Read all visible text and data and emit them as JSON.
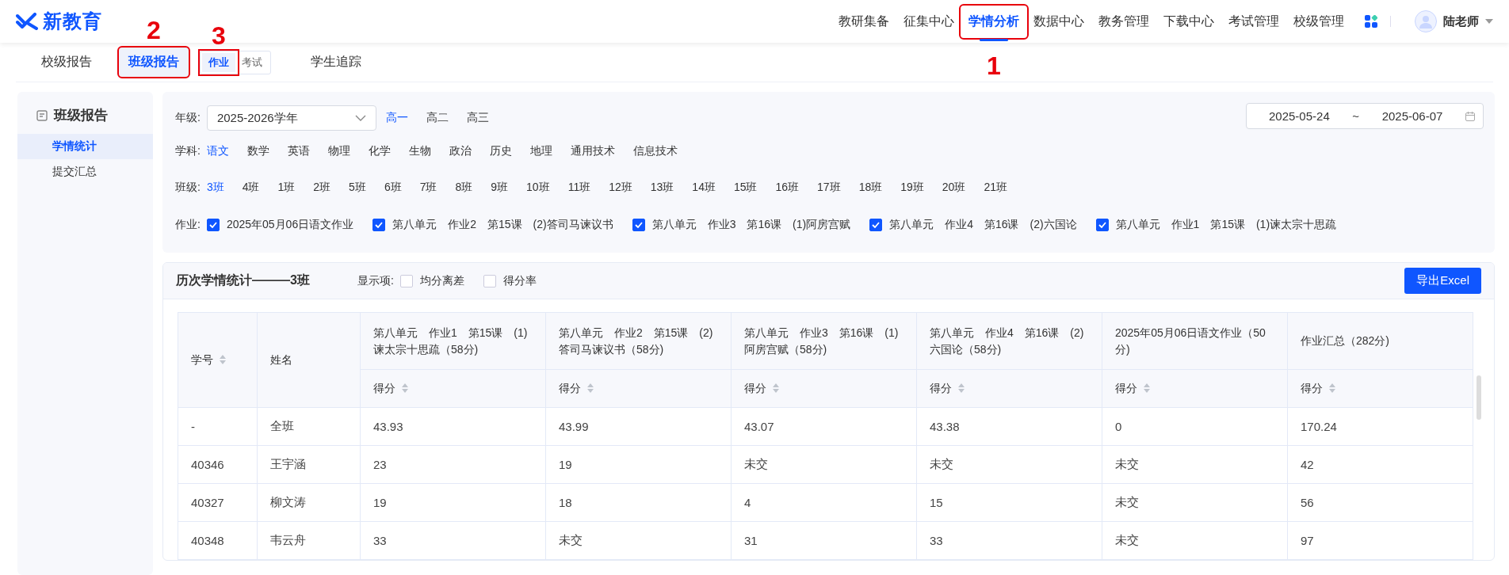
{
  "header": {
    "logo": "新教育",
    "nav": [
      {
        "label": "教研集备",
        "selected": false
      },
      {
        "label": "征集中心",
        "selected": false
      },
      {
        "label": "学情分析",
        "selected": true,
        "callout": "1"
      },
      {
        "label": "数据中心",
        "selected": false
      },
      {
        "label": "教务管理",
        "selected": false
      },
      {
        "label": "下载中心",
        "selected": false
      },
      {
        "label": "考试管理",
        "selected": false
      },
      {
        "label": "校级管理",
        "selected": false
      }
    ],
    "user": "陆老师"
  },
  "tabs": [
    {
      "label": "校级报告",
      "selected": false
    },
    {
      "label": "班级报告",
      "selected": true,
      "callout": "2",
      "subtabs": [
        {
          "label": "作业",
          "selected": true,
          "callout": "3"
        },
        {
          "label": "考试",
          "selected": false
        }
      ]
    },
    {
      "label": "学生追踪",
      "selected": false
    }
  ],
  "sidebar": {
    "title": "班级报告",
    "items": [
      {
        "label": "学情统计",
        "selected": true
      },
      {
        "label": "提交汇总",
        "selected": false
      }
    ]
  },
  "filters": {
    "grade": {
      "label": "年级:",
      "value": "2025-2026学年",
      "options": [
        {
          "label": "高一",
          "selected": true
        },
        {
          "label": "高二",
          "selected": false
        },
        {
          "label": "高三",
          "selected": false
        }
      ]
    },
    "date_range": {
      "start": "2025-05-24",
      "separator": "~",
      "end": "2025-06-07"
    },
    "subject": {
      "label": "学科:",
      "options": [
        {
          "label": "语文",
          "selected": true
        },
        {
          "label": "数学",
          "selected": false
        },
        {
          "label": "英语",
          "selected": false
        },
        {
          "label": "物理",
          "selected": false
        },
        {
          "label": "化学",
          "selected": false
        },
        {
          "label": "生物",
          "selected": false
        },
        {
          "label": "政治",
          "selected": false
        },
        {
          "label": "历史",
          "selected": false
        },
        {
          "label": "地理",
          "selected": false
        },
        {
          "label": "通用技术",
          "selected": false
        },
        {
          "label": "信息技术",
          "selected": false
        }
      ]
    },
    "class": {
      "label": "班级:",
      "options": [
        {
          "label": "3班",
          "selected": true
        },
        {
          "label": "4班",
          "selected": false
        },
        {
          "label": "1班",
          "selected": false
        },
        {
          "label": "2班",
          "selected": false
        },
        {
          "label": "5班",
          "selected": false
        },
        {
          "label": "6班",
          "selected": false
        },
        {
          "label": "7班",
          "selected": false
        },
        {
          "label": "8班",
          "selected": false
        },
        {
          "label": "9班",
          "selected": false
        },
        {
          "label": "10班",
          "selected": false
        },
        {
          "label": "11班",
          "selected": false
        },
        {
          "label": "12班",
          "selected": false
        },
        {
          "label": "13班",
          "selected": false
        },
        {
          "label": "14班",
          "selected": false
        },
        {
          "label": "15班",
          "selected": false
        },
        {
          "label": "16班",
          "selected": false
        },
        {
          "label": "17班",
          "selected": false
        },
        {
          "label": "18班",
          "selected": false
        },
        {
          "label": "19班",
          "selected": false
        },
        {
          "label": "20班",
          "selected": false
        },
        {
          "label": "21班",
          "selected": false
        }
      ]
    },
    "homework": {
      "label": "作业:",
      "items": [
        {
          "label": "2025年05月06日语文作业",
          "checked": true
        },
        {
          "label": "第八单元　作业2　第15课　(2)答司马谏议书",
          "checked": true
        },
        {
          "label": "第八单元　作业3　第16课　(1)阿房宫赋",
          "checked": true
        },
        {
          "label": "第八单元　作业4　第16课　(2)六国论",
          "checked": true
        },
        {
          "label": "第八单元　作业1　第15课　(1)谏太宗十思疏",
          "checked": true
        }
      ]
    }
  },
  "stats": {
    "title": "历次学情统计———3班",
    "display_label": "显示项:",
    "display_options": [
      {
        "label": "均分离差",
        "checked": false
      },
      {
        "label": "得分率",
        "checked": false
      }
    ],
    "export": "导出Excel",
    "table": {
      "columns": [
        {
          "label": "学号",
          "sortable": true
        },
        {
          "label": "姓名",
          "sortable": false
        },
        {
          "label": "第八单元　作业1　第15课　(1)谏太宗十思疏（58分)",
          "sub": {
            "label": "得分",
            "sortable": true
          }
        },
        {
          "label": "第八单元　作业2　第15课　(2)答司马谏议书（58分)",
          "sub": {
            "label": "得分",
            "sortable": true
          }
        },
        {
          "label": "第八单元　作业3　第16课　(1)阿房宫赋（58分)",
          "sub": {
            "label": "得分",
            "sortable": true
          }
        },
        {
          "label": "第八单元　作业4　第16课　(2)六国论（58分)",
          "sub": {
            "label": "得分",
            "sortable": true
          }
        },
        {
          "label": "2025年05月06日语文作业（50分)",
          "sub": {
            "label": "得分",
            "sortable": true
          }
        },
        {
          "label": "作业汇总（282分)",
          "sub": {
            "label": "得分",
            "sortable": true
          }
        }
      ],
      "rows": [
        [
          "-",
          "全班",
          "43.93",
          "43.99",
          "43.07",
          "43.38",
          "0",
          "170.24"
        ],
        [
          "40346",
          "王宇涵",
          "23",
          "19",
          "未交",
          "未交",
          "未交",
          "42"
        ],
        [
          "40327",
          "柳文涛",
          "19",
          "18",
          "4",
          "15",
          "未交",
          "56"
        ],
        [
          "40348",
          "韦云舟",
          "33",
          "未交",
          "31",
          "33",
          "未交",
          "97"
        ]
      ]
    }
  }
}
